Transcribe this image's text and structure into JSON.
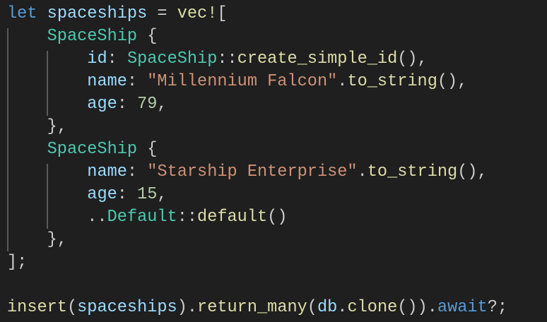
{
  "colors": {
    "background": "#1f1f1f",
    "keyword": "#569cd6",
    "variable": "#9cdcfe",
    "type": "#4ec9b0",
    "function": "#dcdcaa",
    "string": "#ce9178",
    "number": "#b5cea8",
    "punctuation": "#cccccc"
  },
  "code": {
    "language": "rust",
    "lines": [
      [
        {
          "t": "let",
          "c": "kw"
        },
        {
          "t": " "
        },
        {
          "t": "spaceships",
          "c": "var"
        },
        {
          "t": " = "
        },
        {
          "t": "vec!",
          "c": "fn"
        },
        {
          "t": "["
        }
      ],
      [
        {
          "t": "    "
        },
        {
          "t": "SpaceShip",
          "c": "type"
        },
        {
          "t": " {"
        }
      ],
      [
        {
          "t": "        "
        },
        {
          "t": "id",
          "c": "var"
        },
        {
          "t": ": "
        },
        {
          "t": "SpaceShip",
          "c": "type"
        },
        {
          "t": "::"
        },
        {
          "t": "create_simple_id",
          "c": "fn"
        },
        {
          "t": "(),"
        }
      ],
      [
        {
          "t": "        "
        },
        {
          "t": "name",
          "c": "var"
        },
        {
          "t": ": "
        },
        {
          "t": "\"Millennium Falcon\"",
          "c": "str"
        },
        {
          "t": "."
        },
        {
          "t": "to_string",
          "c": "fn"
        },
        {
          "t": "(),"
        }
      ],
      [
        {
          "t": "        "
        },
        {
          "t": "age",
          "c": "var"
        },
        {
          "t": ": "
        },
        {
          "t": "79",
          "c": "num"
        },
        {
          "t": ","
        }
      ],
      [
        {
          "t": "    },"
        }
      ],
      [
        {
          "t": "    "
        },
        {
          "t": "SpaceShip",
          "c": "type"
        },
        {
          "t": " {"
        }
      ],
      [
        {
          "t": "        "
        },
        {
          "t": "name",
          "c": "var"
        },
        {
          "t": ": "
        },
        {
          "t": "\"Starship Enterprise\"",
          "c": "str"
        },
        {
          "t": "."
        },
        {
          "t": "to_string",
          "c": "fn"
        },
        {
          "t": "(),"
        }
      ],
      [
        {
          "t": "        "
        },
        {
          "t": "age",
          "c": "var"
        },
        {
          "t": ": "
        },
        {
          "t": "15",
          "c": "num"
        },
        {
          "t": ","
        }
      ],
      [
        {
          "t": "        .."
        },
        {
          "t": "Default",
          "c": "type"
        },
        {
          "t": "::"
        },
        {
          "t": "default",
          "c": "fn"
        },
        {
          "t": "()"
        }
      ],
      [
        {
          "t": "    },"
        }
      ],
      [
        {
          "t": "];"
        }
      ],
      [],
      [
        {
          "t": "insert",
          "c": "fn"
        },
        {
          "t": "("
        },
        {
          "t": "spaceships",
          "c": "var"
        },
        {
          "t": ")."
        },
        {
          "t": "return_many",
          "c": "fn"
        },
        {
          "t": "("
        },
        {
          "t": "db",
          "c": "var"
        },
        {
          "t": "."
        },
        {
          "t": "clone",
          "c": "fn"
        },
        {
          "t": "())."
        },
        {
          "t": "await",
          "c": "kw"
        },
        {
          "t": "?;"
        }
      ]
    ]
  }
}
